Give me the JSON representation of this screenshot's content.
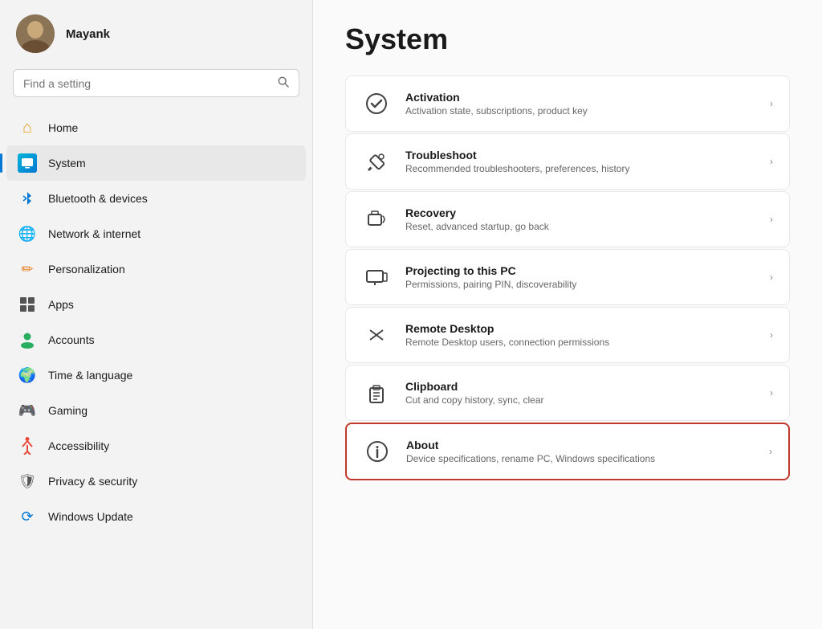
{
  "sidebar": {
    "profile": {
      "username": "Mayank"
    },
    "search": {
      "placeholder": "Find a setting"
    },
    "nav_items": [
      {
        "id": "home",
        "label": "Home",
        "icon": "🏠",
        "icon_class": "icon-home",
        "active": false
      },
      {
        "id": "system",
        "label": "System",
        "icon": "🖥",
        "icon_class": "icon-system",
        "active": true
      },
      {
        "id": "bluetooth",
        "label": "Bluetooth & devices",
        "icon": "🔵",
        "icon_class": "icon-bluetooth",
        "active": false
      },
      {
        "id": "network",
        "label": "Network & internet",
        "icon": "🌐",
        "icon_class": "icon-network",
        "active": false
      },
      {
        "id": "personalization",
        "label": "Personalization",
        "icon": "✏️",
        "icon_class": "icon-personalization",
        "active": false
      },
      {
        "id": "apps",
        "label": "Apps",
        "icon": "▦",
        "icon_class": "icon-apps",
        "active": false
      },
      {
        "id": "accounts",
        "label": "Accounts",
        "icon": "👤",
        "icon_class": "icon-accounts",
        "active": false
      },
      {
        "id": "time",
        "label": "Time & language",
        "icon": "🌍",
        "icon_class": "icon-time",
        "active": false
      },
      {
        "id": "gaming",
        "label": "Gaming",
        "icon": "🎮",
        "icon_class": "icon-gaming",
        "active": false
      },
      {
        "id": "accessibility",
        "label": "Accessibility",
        "icon": "♿",
        "icon_class": "icon-accessibility",
        "active": false
      },
      {
        "id": "privacy",
        "label": "Privacy & security",
        "icon": "🛡",
        "icon_class": "icon-privacy",
        "active": false
      },
      {
        "id": "winupdate",
        "label": "Windows Update",
        "icon": "⟳",
        "icon_class": "icon-winupdate",
        "active": false
      }
    ]
  },
  "main": {
    "page_title": "System",
    "settings_items": [
      {
        "id": "activation",
        "title": "Activation",
        "description": "Activation state, subscriptions, product key",
        "icon": "✓",
        "highlighted": false
      },
      {
        "id": "troubleshoot",
        "title": "Troubleshoot",
        "description": "Recommended troubleshooters, preferences, history",
        "icon": "🔧",
        "highlighted": false
      },
      {
        "id": "recovery",
        "title": "Recovery",
        "description": "Reset, advanced startup, go back",
        "icon": "⊡",
        "highlighted": false
      },
      {
        "id": "projecting",
        "title": "Projecting to this PC",
        "description": "Permissions, pairing PIN, discoverability",
        "icon": "🖥",
        "highlighted": false
      },
      {
        "id": "remote-desktop",
        "title": "Remote Desktop",
        "description": "Remote Desktop users, connection permissions",
        "icon": "✕",
        "highlighted": false
      },
      {
        "id": "clipboard",
        "title": "Clipboard",
        "description": "Cut and copy history, sync, clear",
        "icon": "📋",
        "highlighted": false
      },
      {
        "id": "about",
        "title": "About",
        "description": "Device specifications, rename PC, Windows specifications",
        "icon": "ℹ",
        "highlighted": true
      }
    ]
  }
}
